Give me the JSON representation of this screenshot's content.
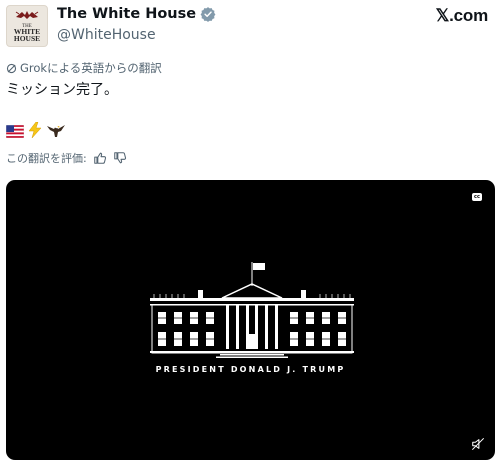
{
  "author": {
    "display_name": "The White House",
    "handle": "@WhiteHouse",
    "avatar_lines": [
      "THE",
      "WHITE",
      "HOUSE"
    ]
  },
  "site_logo": "𝕏.com",
  "translation": {
    "note": "Grokによる英語からの翻訳",
    "rate_prompt": "この翻訳を評価:"
  },
  "tweet": {
    "text": "ミッション完了。",
    "emojis": [
      "flag-us",
      "lightning",
      "eagle"
    ]
  },
  "media": {
    "caption": "PRESIDENT DONALD J. TRUMP",
    "cc_label": "cc"
  },
  "colors": {
    "verified": "#1d9bf0",
    "muted_text": "#536471",
    "media_bg": "#000000",
    "text": "#0f1419"
  }
}
